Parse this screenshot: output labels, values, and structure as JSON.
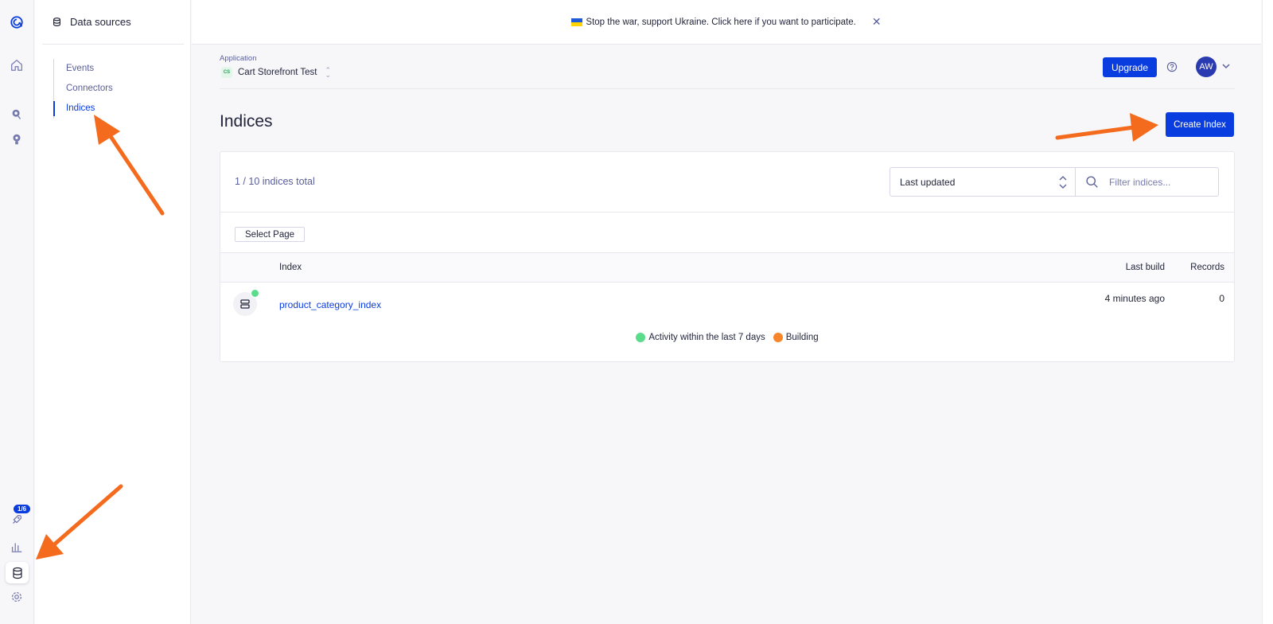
{
  "banner": {
    "text": "Stop the war, support Ukraine. Click here if you want to participate.",
    "close_glyph": "✕",
    "flag_icon": "ukraine-flag-icon"
  },
  "rail": {
    "icons": [
      "algolia-logo-icon",
      "home-icon",
      "search-icon",
      "lightbulb-icon",
      "rocket-icon",
      "bar-chart-icon",
      "database-icon",
      "gear-icon"
    ],
    "onboarding_badge": "1/6"
  },
  "sidebar": {
    "title": "Data sources",
    "items": [
      {
        "label": "Events",
        "active": false
      },
      {
        "label": "Connectors",
        "active": false
      },
      {
        "label": "Indices",
        "active": true
      }
    ]
  },
  "header": {
    "application_label": "Application",
    "app_badge": "CS",
    "app_name": "Cart Storefront Test",
    "upgrade_label": "Upgrade",
    "avatar_initials": "AW"
  },
  "page": {
    "title": "Indices",
    "create_label": "Create Index"
  },
  "card": {
    "count_text": "1 / 10 indices total",
    "sort_value": "Last updated",
    "filter_placeholder": "Filter indices...",
    "select_page_label": "Select Page",
    "columns": {
      "index": "Index",
      "last_build": "Last build",
      "records": "Records"
    },
    "rows": [
      {
        "name": "product_category_index",
        "last_build": "4 minutes ago",
        "records": "0",
        "status": "active"
      }
    ],
    "legend": [
      {
        "label": "Activity within the last 7 days",
        "color": "#5adc8c"
      },
      {
        "label": "Building",
        "color": "#f7862a"
      }
    ]
  },
  "colors": {
    "accent": "#0a3de0",
    "annotation_arrow": "#f56b1d",
    "active_dot": "#5adc8c",
    "building_dot": "#f7862a"
  }
}
